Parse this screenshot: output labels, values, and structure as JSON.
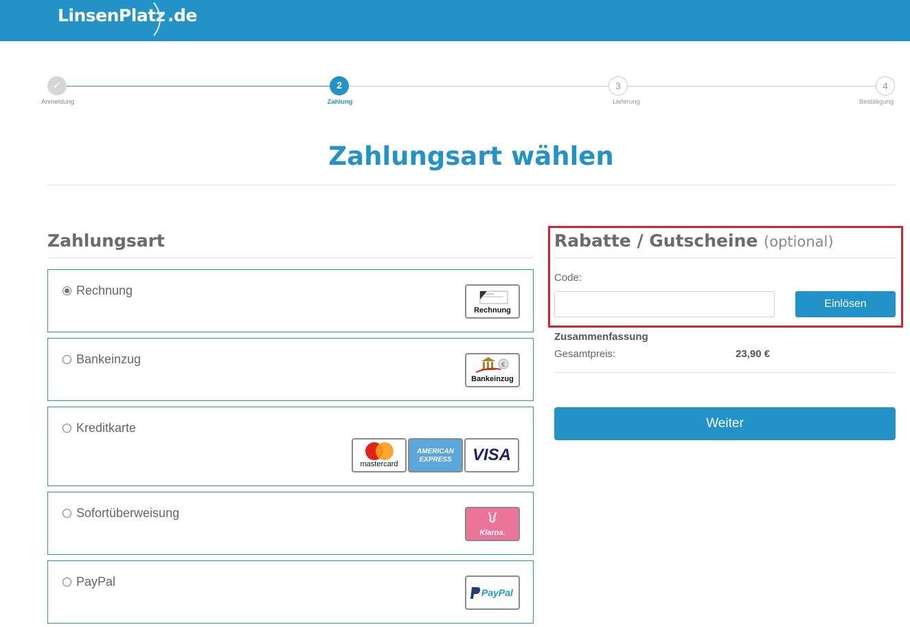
{
  "header": {
    "logo_main": "LinsenPlatz",
    "logo_tld": ".de",
    "background_color": "#2193c9"
  },
  "steps": [
    {
      "number": "✓",
      "label": "Anmeldung",
      "state": "done"
    },
    {
      "number": "2",
      "label": "Zahlung",
      "state": "active"
    },
    {
      "number": "3",
      "label": "Lieferung",
      "state": "pending"
    },
    {
      "number": "4",
      "label": "Bestätigung",
      "state": "pending"
    }
  ],
  "page_title": "Zahlungsart wählen",
  "payment": {
    "heading": "Zahlungsart",
    "options": [
      {
        "label": "Rechnung",
        "selected": true,
        "badges": [
          "Rechnung"
        ]
      },
      {
        "label": "Bankeinzug",
        "selected": false,
        "badges": [
          "Bankeinzug"
        ]
      },
      {
        "label": "Kreditkarte",
        "selected": false,
        "badges": [
          "mastercard",
          "AMERICAN EXPRESS",
          "VISA"
        ]
      },
      {
        "label": "Sofortüberweisung",
        "selected": false,
        "badges": [
          "Klarna."
        ]
      },
      {
        "label": "PayPal",
        "selected": false,
        "badges": [
          "PayPal"
        ]
      }
    ]
  },
  "voucher": {
    "heading": "Rabatte / Gutscheine",
    "heading_suffix": "(optional)",
    "code_label": "Code:",
    "code_value": "",
    "redeem_label": "Einlösen",
    "highlight_color": "#d9212d"
  },
  "summary": {
    "title": "Zusammenfassung",
    "total_label": "Gesamtpreis:",
    "total_value": "23,90 €"
  },
  "next_label": "Weiter",
  "colors": {
    "accent": "#2193c9",
    "box_border": "#2193c9"
  }
}
